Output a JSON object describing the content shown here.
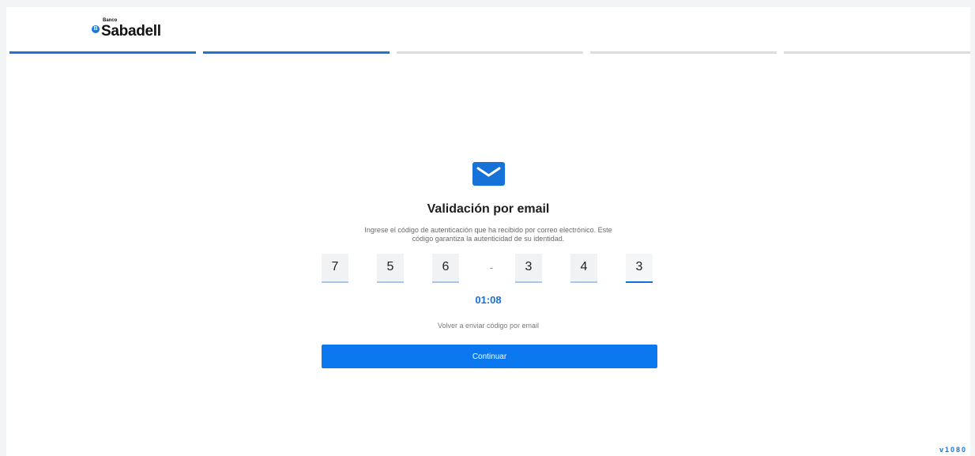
{
  "header": {
    "logo_small": "Banco",
    "logo_main": "Sabadell",
    "logo_mark": "B",
    "steps": [
      {
        "active": true
      },
      {
        "active": true
      },
      {
        "active": false
      },
      {
        "active": false
      },
      {
        "active": false
      }
    ]
  },
  "main": {
    "icon": "envelope-icon",
    "title": "Validación por email",
    "description_line1": "Ingrese el código de autenticación que ha recibido por correo electrónico. Este",
    "description_line2": "código garantiza la autenticidad de su identidad.",
    "code": {
      "d1": "7",
      "d2": "5",
      "d3": "6",
      "separator": "-",
      "d4": "3",
      "d5": "4",
      "d6": "3"
    },
    "timer": "01:08",
    "resend_label": "Volver a enviar código por email",
    "continue_label": "Continuar"
  },
  "footer": {
    "version": "v1080"
  },
  "colors": {
    "accent": "#0c78f0",
    "progress_active": "#1d74d1",
    "progress_inactive": "#dcdcdc"
  }
}
